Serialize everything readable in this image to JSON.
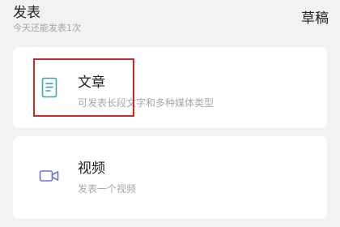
{
  "header": {
    "title": "发表",
    "subtitle": "今天还能发表1次",
    "draft_label": "草稿"
  },
  "options": [
    {
      "title": "文章",
      "description": "可发表长段文字和多种媒体类型",
      "icon": "article-icon",
      "icon_color": "#3aa7b2"
    },
    {
      "title": "视频",
      "description": "发表一个视频",
      "icon": "video-icon",
      "icon_color": "#6f73c8"
    }
  ],
  "colors": {
    "background": "#f2f2f3",
    "card": "#ffffff",
    "highlight": "#c82a2a"
  }
}
